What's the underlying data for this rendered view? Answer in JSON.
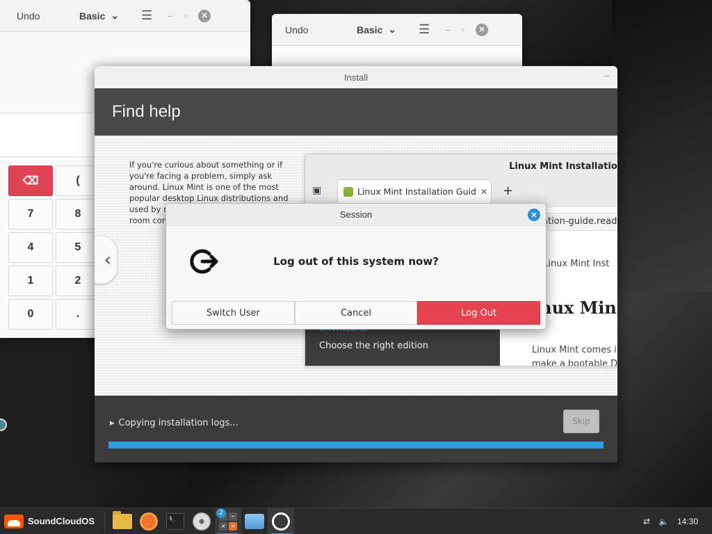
{
  "calculator_back": {
    "undo": "Undo",
    "mode": "Basic",
    "keys": [
      "",
      "(",
      "7",
      "8",
      "4",
      "5",
      "1",
      "2",
      "0",
      "."
    ]
  },
  "calculator_front": {
    "undo": "Undo",
    "mode": "Basic"
  },
  "installer": {
    "title": "Install",
    "heading": "Find help",
    "help_text": "If you're curious about something or if you're facing a problem, simply ask around. Linux Mint is one of the most popular desktop Linux distributions and used by m a user gui collection chat room communi",
    "browser": {
      "title": "Linux Mint Installation",
      "tab_label": "Linux Mint Installation Guid",
      "url": "ation-guide.readt",
      "breadcrumb": "» Linux Mint Inst",
      "heading": "inux Min",
      "paragraph_1": "Linux Mint comes in",
      "paragraph_2": "make a bootable DV",
      "sidebar_download": "DOWNLOAD",
      "sidebar_choose": "Choose the right edition"
    },
    "status": "Copying installation logs...",
    "skip_label": "Skip",
    "progress_percent": 100
  },
  "session": {
    "title": "Session",
    "question": "Log out of this system now?",
    "buttons": {
      "switch_user": "Switch User",
      "cancel": "Cancel",
      "log_out": "Log Out"
    }
  },
  "taskbar": {
    "menu_label": "SoundCloudOS",
    "calc_badge": "2",
    "clock": "14:30"
  },
  "colors": {
    "accent_red": "#e5434f",
    "accent_blue": "#2e9ee0"
  }
}
